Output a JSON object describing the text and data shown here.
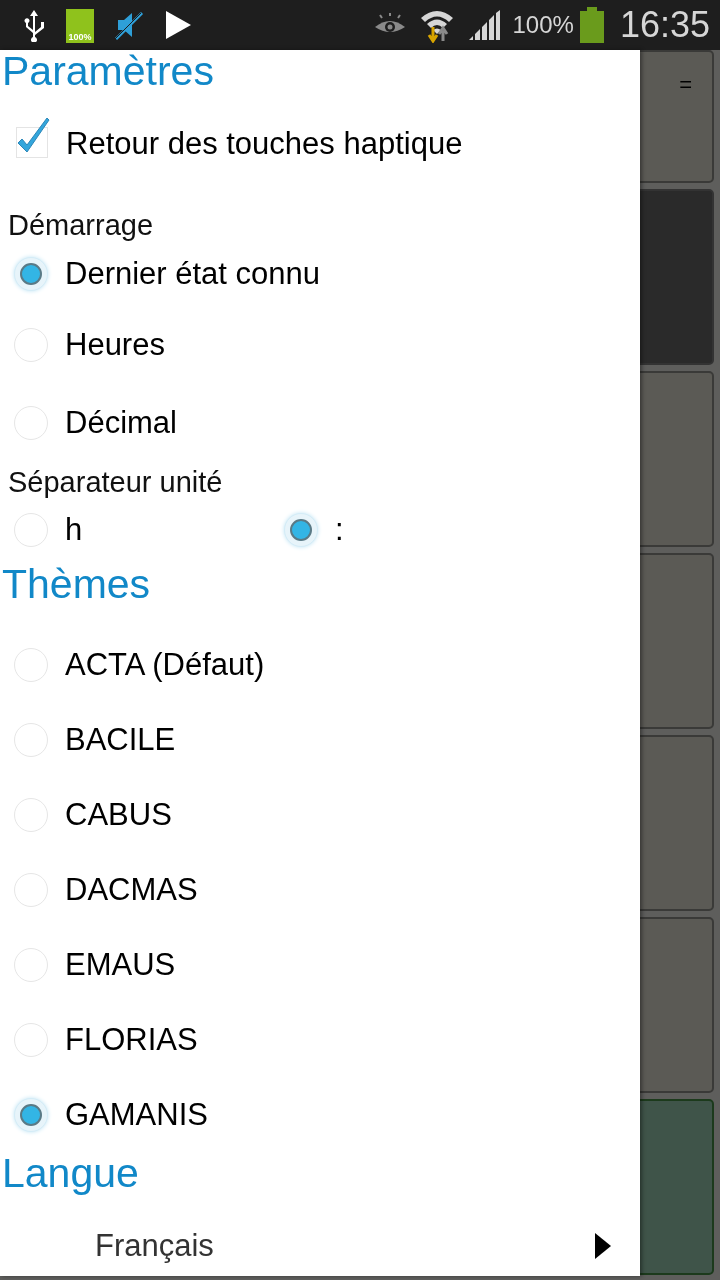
{
  "status_bar": {
    "battery_badge": "100%",
    "battery_percent": "100%",
    "time": "16:35"
  },
  "settings": {
    "title": "Paramètres",
    "haptic": {
      "label": "Retour des touches haptique",
      "checked": true
    },
    "startup": {
      "label": "Démarrage",
      "options": [
        {
          "label": "Dernier état connu",
          "selected": true
        },
        {
          "label": "Heures",
          "selected": false
        },
        {
          "label": "Décimal",
          "selected": false
        }
      ]
    },
    "separator": {
      "label": "Séparateur unité",
      "options": [
        {
          "label": "h",
          "selected": false
        },
        {
          "label": ":",
          "selected": true
        }
      ]
    }
  },
  "themes": {
    "title": "Thèmes",
    "options": [
      {
        "label": "ACTA (Défaut)",
        "selected": false
      },
      {
        "label": "BACILE",
        "selected": false
      },
      {
        "label": "CABUS",
        "selected": false
      },
      {
        "label": "DACMAS",
        "selected": false
      },
      {
        "label": "EMAUS",
        "selected": false
      },
      {
        "label": "FLORIAS",
        "selected": false
      },
      {
        "label": "GAMANIS",
        "selected": true
      }
    ]
  },
  "language": {
    "title": "Langue",
    "value": "Français"
  },
  "background": {
    "key_label": "="
  }
}
